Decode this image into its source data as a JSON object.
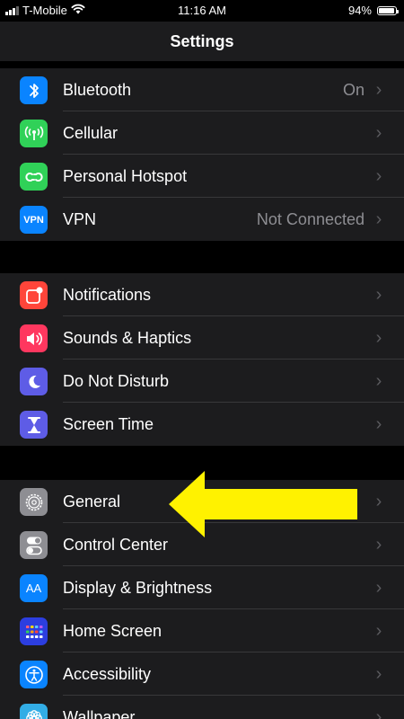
{
  "status_bar": {
    "carrier": "T-Mobile",
    "time": "11:16 AM",
    "battery_percent": "94%",
    "battery_level": 0.94
  },
  "header": {
    "title": "Settings"
  },
  "groups": [
    {
      "rows": [
        {
          "label": "Bluetooth",
          "value": "On",
          "icon": "bluetooth-icon",
          "color": "#0a84ff"
        },
        {
          "label": "Cellular",
          "value": "",
          "icon": "antenna-icon",
          "color": "#30d158"
        },
        {
          "label": "Personal Hotspot",
          "value": "",
          "icon": "hotspot-icon",
          "color": "#30d158"
        },
        {
          "label": "VPN",
          "value": "Not Connected",
          "icon": "vpn-icon",
          "icon_text": "VPN",
          "color": "#0a84ff"
        }
      ]
    },
    {
      "rows": [
        {
          "label": "Notifications",
          "value": "",
          "icon": "notifications-icon",
          "color": "#ff453a"
        },
        {
          "label": "Sounds & Haptics",
          "value": "",
          "icon": "speaker-icon",
          "color": "#ff375f"
        },
        {
          "label": "Do Not Disturb",
          "value": "",
          "icon": "moon-icon",
          "color": "#5e5ce6"
        },
        {
          "label": "Screen Time",
          "value": "",
          "icon": "hourglass-icon",
          "color": "#5e5ce6"
        }
      ]
    },
    {
      "rows": [
        {
          "label": "General",
          "value": "",
          "icon": "gear-icon",
          "color": "#8e8e93"
        },
        {
          "label": "Control Center",
          "value": "",
          "icon": "toggles-icon",
          "color": "#8e8e93"
        },
        {
          "label": "Display & Brightness",
          "value": "",
          "icon": "display-icon",
          "icon_text": "AA",
          "color": "#0a84ff"
        },
        {
          "label": "Home Screen",
          "value": "",
          "icon": "home-screen-icon",
          "color": "#2c3ee0"
        },
        {
          "label": "Accessibility",
          "value": "",
          "icon": "accessibility-icon",
          "color": "#0a84ff"
        },
        {
          "label": "Wallpaper",
          "value": "",
          "icon": "wallpaper-icon",
          "color": "#32ade6"
        }
      ]
    }
  ],
  "annotation": {
    "arrow_color": "#fff200",
    "arrow_target": "General"
  }
}
